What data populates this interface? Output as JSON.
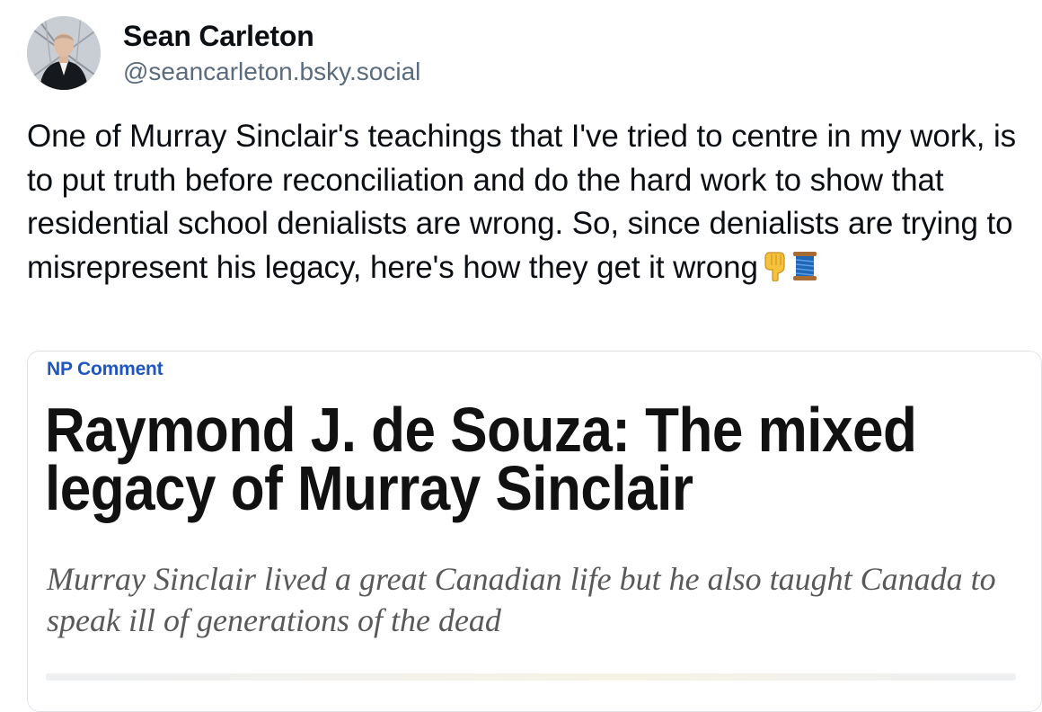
{
  "post": {
    "author": {
      "name": "Sean Carleton",
      "handle": "@seancarleton.bsky.social",
      "avatar_icon": "avatar-photo"
    },
    "text": "One of Murray Sinclair's teachings that I've tried to centre in my work, is to put truth before reconciliation and do the hard work to show that residential school denialists are wrong. So, since denialists are trying to misrepresent his legacy, here's how they get it wrong",
    "emojis": [
      "backhand-index-pointing-down-icon",
      "spool-of-thread-icon"
    ]
  },
  "embed": {
    "section": "NP Comment",
    "headline": "Raymond J. de Souza: The mixed legacy of Murray Sinclair",
    "deck": "Murray Sinclair lived a great Canadian life but he also taught Canada to speak ill of generations of the dead"
  },
  "colors": {
    "handle": "#5a6b7d",
    "section_label": "#1f56c2",
    "deck": "#595959",
    "card_border": "#dfe3e8"
  }
}
